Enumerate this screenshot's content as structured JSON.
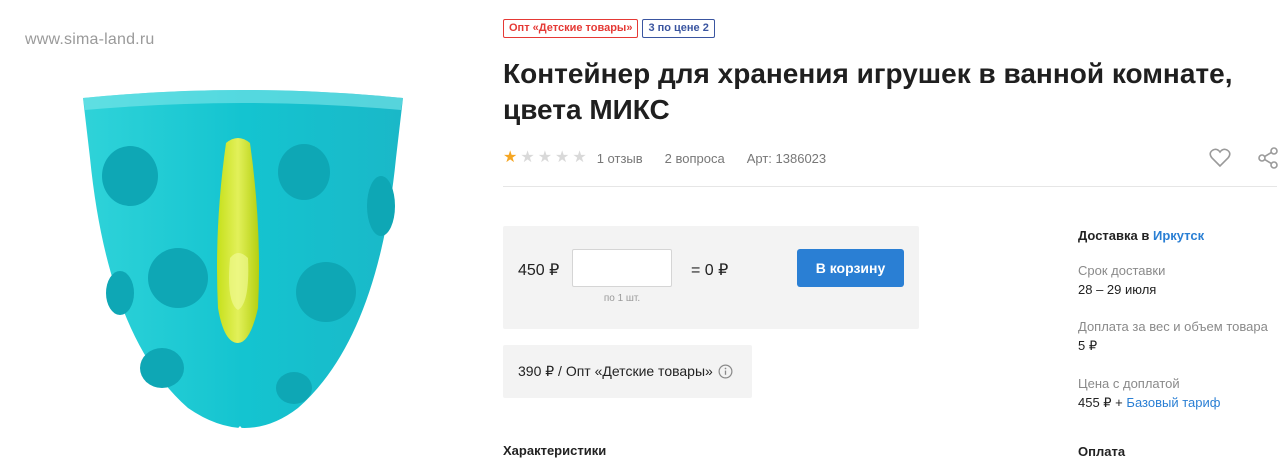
{
  "watermark": "www.sima-land.ru",
  "badges": {
    "wholesale": "Опт «Детские товары»",
    "price_deal": "3 по цене 2"
  },
  "product": {
    "title": "Контейнер для хранения игрушек в ванной комнате, цвета МИКС",
    "rating": 1,
    "rating_max": 5,
    "reviews": "1 отзыв",
    "questions": "2 вопроса",
    "article": "Арт: 1386023"
  },
  "buy": {
    "price": "450 ₽",
    "qty_value": "",
    "qty_note": "по 1 шт.",
    "total": "= 0 ₽",
    "cart_label": "В корзину"
  },
  "wholesale_price": "390 ₽ / Опт «Детские товары»",
  "sections": {
    "characteristics": "Характеристики",
    "payment": "Оплата"
  },
  "delivery": {
    "heading": "Доставка в",
    "city": "Иркутск",
    "term_label": "Срок доставки",
    "term_value": "28 – 29 июля",
    "surcharge_label": "Доплата за вес и объем товара",
    "surcharge_value": "5 ₽",
    "price_label": "Цена с доплатой",
    "price_value": "455 ₽ +",
    "tariff_link": "Базовый тариф"
  },
  "colors": {
    "accent_blue": "#2a7fd4",
    "star_filled": "#f5a623",
    "badge_red": "#e53935",
    "badge_blue": "#3a55a0"
  }
}
